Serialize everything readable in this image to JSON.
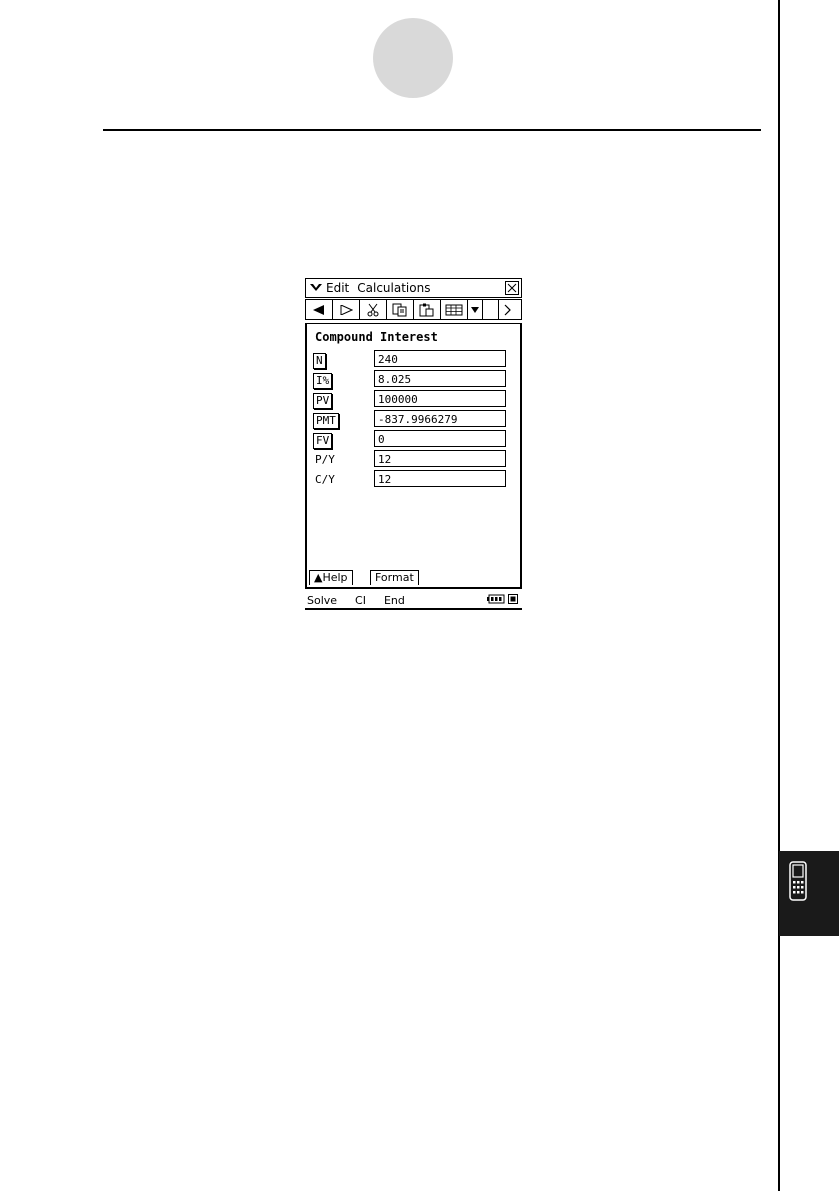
{
  "app": {
    "menu": [
      "Edit",
      "Calculations"
    ]
  },
  "panel": {
    "title": "Compound Interest",
    "rows": [
      {
        "label": "N",
        "value": "240",
        "boxed": true
      },
      {
        "label": "I%",
        "value": "8.025",
        "boxed": true
      },
      {
        "label": "PV",
        "value": "100000",
        "boxed": true
      },
      {
        "label": "PMT",
        "value": "-837.9966279",
        "boxed": true
      },
      {
        "label": "FV",
        "value": "0",
        "boxed": true
      },
      {
        "label": "P/Y",
        "value": "12",
        "boxed": false
      },
      {
        "label": "C/Y",
        "value": "12",
        "boxed": false
      }
    ]
  },
  "tabs": {
    "help": "▲Help",
    "format": "Format"
  },
  "statusbar": {
    "solve": "Solve",
    "ci": "CI",
    "end": "End"
  },
  "icons": {
    "menu": "menu-chevron-icon",
    "close": "close-icon",
    "battery": "battery-icon",
    "side_tab": "calculator-icon"
  }
}
